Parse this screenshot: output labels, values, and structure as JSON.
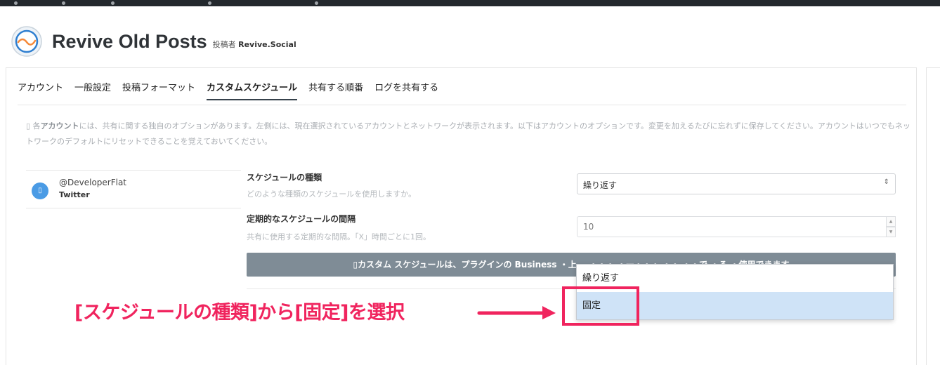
{
  "app": {
    "title": "Revive Old Posts",
    "by_prefix": "投稿者",
    "by_author": "Revive.Social"
  },
  "tabs": [
    {
      "label": "アカウント",
      "active": false
    },
    {
      "label": "一般設定",
      "active": false
    },
    {
      "label": "投稿フォーマット",
      "active": false
    },
    {
      "label": "カスタムスケジュール",
      "active": true
    },
    {
      "label": "共有する順番",
      "active": false
    },
    {
      "label": "ログを共有する",
      "active": false
    }
  ],
  "notice": {
    "glyph": "▯",
    "prefix": "各",
    "bold": "アカウント",
    "rest": "には、共有に関する独自のオプションがあります。左側には、現在選択されているアカウントとネットワークが表示されます。以下はアカウントのオプションです。変更を加えるたびに忘れずに保存してください。アカウントはいつでもネットワークのデフォルトにリセットできることを覚えておいてください。"
  },
  "account": {
    "avatar_glyph": "▯",
    "handle": "@DeveloperFlat",
    "network": "Twitter"
  },
  "schedule_type": {
    "label": "スケジュールの種類",
    "help": "どのような種類のスケジュールを使用しますか。",
    "value": "繰り返す",
    "arrow": "⇕"
  },
  "interval": {
    "label": "定期的なスケジュールの間隔",
    "help": "共有に使用する定期的な間隔。「X」時間ごとに1回。",
    "value": "10",
    "spin_up": "▲",
    "spin_down": "▼"
  },
  "banner": {
    "text": "▯カスタム スケジュールは、プラグインの Business ・上... ・・・ ・ー・・・ ・・ ・・で ・る ・使用できます"
  },
  "dropdown": {
    "options": [
      {
        "label": "繰り返す",
        "selected": false
      },
      {
        "label": "固定",
        "selected": true
      }
    ]
  },
  "annotation": {
    "text": "[スケジュールの種類]から[固定]を選択"
  },
  "colors": {
    "accent_pink": "#f0245e",
    "banner_gray": "#7f8c96",
    "avatar_blue": "#4a9be5",
    "option_selected": "#cfe3f7",
    "topbar": "#23282d"
  }
}
